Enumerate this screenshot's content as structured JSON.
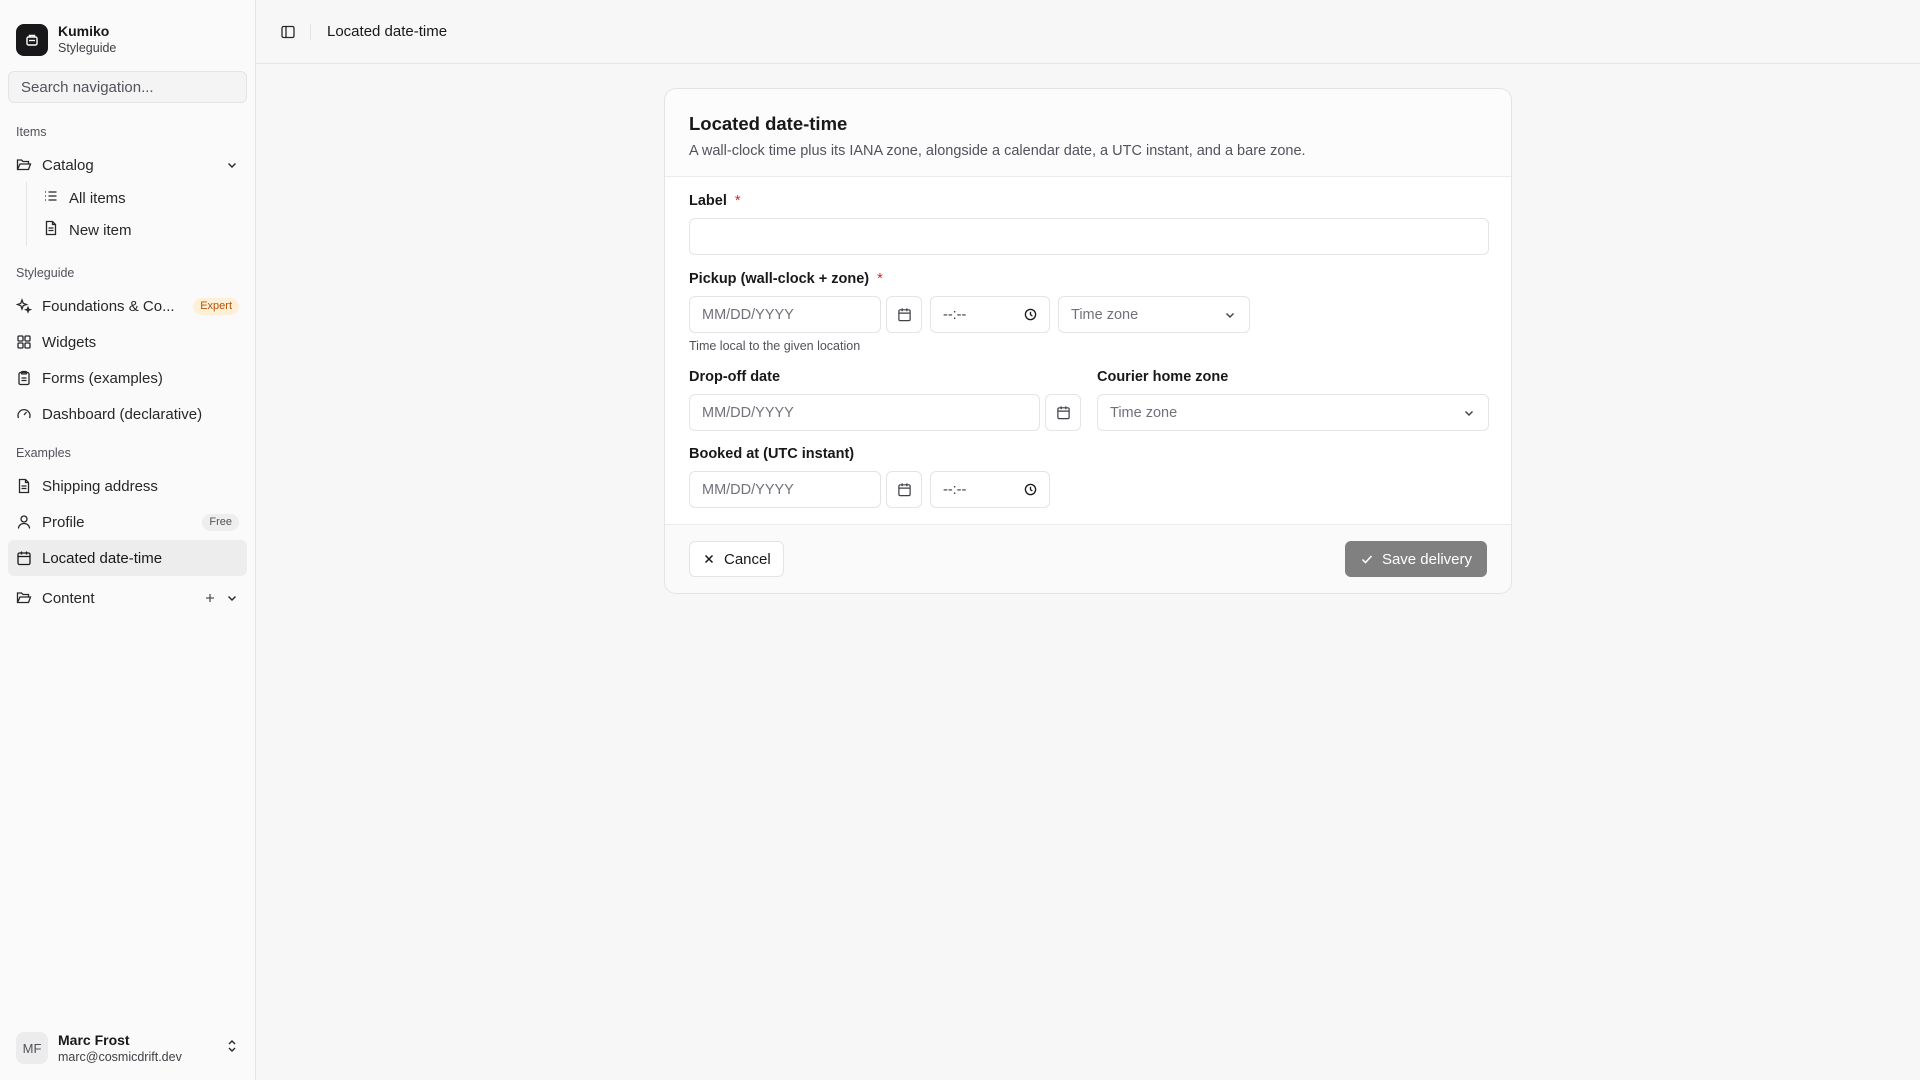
{
  "brand": {
    "name": "Kumiko",
    "subtitle": "Styleguide"
  },
  "search": {
    "placeholder": "Search navigation..."
  },
  "sections": {
    "items": "Items",
    "styleguide": "Styleguide",
    "examples": "Examples"
  },
  "nav": {
    "catalog": "Catalog",
    "all_items": "All items",
    "new_item": "New item",
    "foundations": "Foundations & Co...",
    "foundations_badge": "Expert",
    "widgets": "Widgets",
    "forms": "Forms (examples)",
    "dashboard": "Dashboard (declarative)",
    "shipping": "Shipping address",
    "profile": "Profile",
    "profile_badge": "Free",
    "located": "Located date-time",
    "content": "Content"
  },
  "user": {
    "initials": "MF",
    "name": "Marc Frost",
    "email": "marc@cosmicdrift.dev"
  },
  "topbar": {
    "breadcrumb": "Located date-time"
  },
  "form": {
    "title": "Located date-time",
    "description": "A wall-clock time plus its IANA zone, alongside a calendar date, a UTC instant, and a bare zone.",
    "label_field": {
      "label": "Label",
      "required": "*",
      "value": ""
    },
    "pickup": {
      "label": "Pickup (wall-clock + zone)",
      "required": "*",
      "date_placeholder": "MM/DD/YYYY",
      "time_placeholder": "--:--",
      "zone_placeholder": "Time zone",
      "hint": "Time local to the given location"
    },
    "dropoff": {
      "label": "Drop-off date",
      "date_placeholder": "MM/DD/YYYY"
    },
    "courier": {
      "label": "Courier home zone",
      "zone_placeholder": "Time zone"
    },
    "booked": {
      "label": "Booked at (UTC instant)",
      "date_placeholder": "MM/DD/YYYY",
      "time_placeholder": "--:--"
    },
    "cancel_label": "Cancel",
    "save_label": "Save delivery"
  },
  "colors": {
    "accent": "#18181b",
    "required": "#dc2626",
    "save_disabled": "#808080"
  }
}
